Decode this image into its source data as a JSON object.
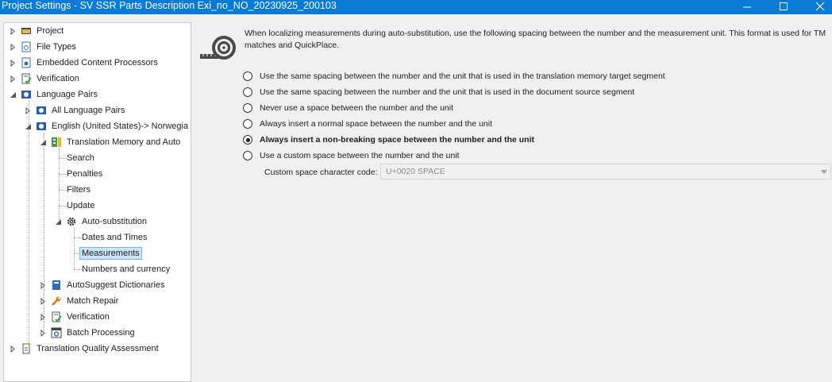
{
  "window": {
    "title": "Project Settings - SV SSR Parts Description Exi_no_NO_20230925_200103",
    "minimize_glyph": "—",
    "maximize_glyph": "☐",
    "close_glyph": "✕"
  },
  "tree": {
    "items": [
      {
        "label": "Project",
        "icon": "project-folder-icon"
      },
      {
        "label": "File Types",
        "icon": "file-types-icon"
      },
      {
        "label": "Embedded Content Processors",
        "icon": "embedded-content-icon"
      },
      {
        "label": "Verification",
        "icon": "verification-icon"
      },
      {
        "label": "Language Pairs",
        "icon": "language-pairs-icon"
      },
      {
        "label": "All Language Pairs",
        "icon": "language-pairs-icon"
      },
      {
        "label": "English (United States)-> Norwegia",
        "icon": "language-pairs-icon"
      },
      {
        "label": "Translation Memory and Auto",
        "icon": "translation-memory-icon"
      },
      {
        "label": "Search"
      },
      {
        "label": "Penalties"
      },
      {
        "label": "Filters"
      },
      {
        "label": "Update"
      },
      {
        "label": "Auto-substitution",
        "icon": "gear-icon"
      },
      {
        "label": "Dates and Times"
      },
      {
        "label": "Measurements",
        "selected": true
      },
      {
        "label": "Numbers and currency"
      },
      {
        "label": "AutoSuggest Dictionaries",
        "icon": "dictionary-icon"
      },
      {
        "label": "Match Repair",
        "icon": "wrench-icon"
      },
      {
        "label": "Verification",
        "icon": "verification-icon"
      },
      {
        "label": "Batch Processing",
        "icon": "batch-processing-icon"
      },
      {
        "label": "Translation Quality Assessment",
        "icon": "quality-assessment-icon"
      }
    ]
  },
  "panel": {
    "description": "When localizing measurements during auto-substitution, use the following spacing between the number and the measurement unit. This format is used for TM matches and QuickPlace.",
    "options": [
      {
        "label": "Use the same spacing between the number and the unit that is used in the translation memory target segment",
        "checked": false
      },
      {
        "label": "Use the same spacing between the number and the unit that is used in the document source segment",
        "checked": false
      },
      {
        "label": "Never use a space between the number and the unit",
        "checked": false
      },
      {
        "label": "Always insert a normal space between the number and the unit",
        "checked": false
      },
      {
        "label": "Always insert a non-breaking space between the number and the unit",
        "checked": true
      },
      {
        "label": "Use a custom space between the number and the unit",
        "checked": false
      }
    ],
    "custom_label": "Custom space character code:",
    "custom_value": "U+0020 SPACE"
  },
  "colors": {
    "titlebar": "#0a7bd4",
    "selection": "#cce4f7"
  }
}
